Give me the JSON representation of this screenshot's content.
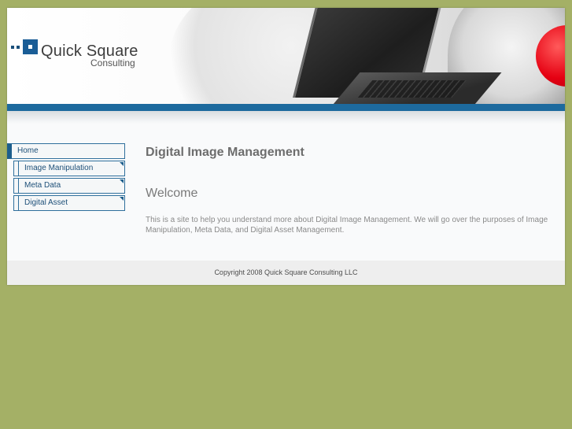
{
  "logo": {
    "title": "Quick Square",
    "subtitle": "Consulting"
  },
  "nav": {
    "home": "Home",
    "items": [
      {
        "label": "Image Manipulation"
      },
      {
        "label": "Meta Data"
      },
      {
        "label": "Digital Asset"
      }
    ]
  },
  "main": {
    "title": "Digital Image Management",
    "welcome": "Welcome",
    "body": "This is a site to help you understand more about Digital Image Management. We will go over the purposes of Image Manipulation, Meta Data, and Digital Asset Management."
  },
  "footer": {
    "copyright": "Copyright 2008 Quick Square Consulting LLC"
  },
  "colors": {
    "background": "#a4b066",
    "accent": "#1d6a9e",
    "red": "#e50012"
  }
}
